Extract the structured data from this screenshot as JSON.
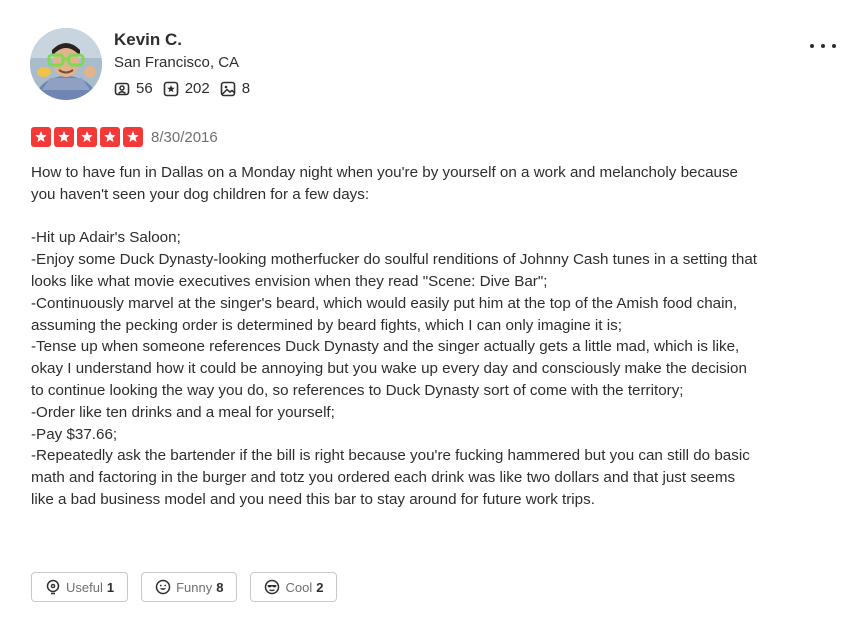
{
  "user": {
    "name": "Kevin C.",
    "location": "San Francisco, CA",
    "friends": "56",
    "reviews": "202",
    "photos": "8"
  },
  "review": {
    "rating": 5,
    "date": "8/30/2016",
    "paragraphs": [
      "How to have fun in Dallas on a Monday night when you're by yourself on a work and melancholy because you haven't seen your dog children for a few days:",
      "",
      "-Hit up Adair's Saloon;",
      "-Enjoy some Duck Dynasty-looking motherfucker do soulful renditions of Johnny Cash tunes in a setting that looks like what movie executives envision when they read \"Scene: Dive Bar\";",
      "-Continuously marvel at the singer's beard, which would easily put him at the top of the Amish food chain, assuming the pecking order is determined by beard fights, which I can only imagine it is;",
      "-Tense up when someone references Duck Dynasty and the singer actually gets a little mad, which is like, okay I understand how it could be annoying but you wake up every day and consciously make the decision to continue looking the way you do, so references to Duck Dynasty sort of come with the territory;",
      "-Order like ten drinks and a meal for yourself;",
      "-Pay $37.66;",
      "-Repeatedly ask the bartender if the bill is right because you're fucking hammered but you can still do basic math and factoring in the burger and totz you ordered each drink was like two dollars and that just seems like a bad business model and you need this bar to stay around for future work trips."
    ]
  },
  "reactions": {
    "useful_label": "Useful",
    "useful_count": "1",
    "funny_label": "Funny",
    "funny_count": "8",
    "cool_label": "Cool",
    "cool_count": "2"
  },
  "colors": {
    "star": "#f43939",
    "text": "#2d2e2f",
    "muted": "#6e7072",
    "border": "#c8c9ca"
  },
  "icons": [
    "friends-icon",
    "review-star-icon",
    "photo-icon",
    "more-options-icon",
    "star-icon",
    "lightbulb-icon",
    "smile-icon",
    "sunglasses-face-icon"
  ]
}
